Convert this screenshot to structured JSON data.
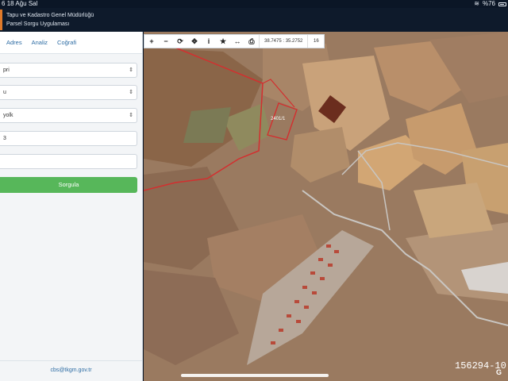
{
  "status": {
    "time_prefix": "6",
    "date": "18 Ağu Sal",
    "battery": "%76"
  },
  "header": {
    "line1": "Tapu ve Kadastro Genel Müdürlüğü",
    "line2": "Parsel Sorgu Uygulaması"
  },
  "tabs": [
    "Adres",
    "Analiz",
    "Coğrafi"
  ],
  "form": {
    "field1": "pri",
    "field2": "u",
    "field3": "yolk",
    "field4": "3",
    "field5": "",
    "submit": "Sorgula"
  },
  "footer": {
    "email": "cbs@tkgm.gov.tr"
  },
  "map": {
    "coords": "38.7475 : 35.2752",
    "zoom": "16",
    "parcel_label": "2401/1",
    "code": "156294-10",
    "logo": "G",
    "colors": {
      "parcel_outline": "#d32f2f",
      "selected_parcel": "#8b1a1a"
    }
  },
  "toolbar_icons": [
    "plus-icon",
    "minus-icon",
    "refresh-icon",
    "locate-icon",
    "info-icon",
    "star-icon",
    "measure-icon",
    "print-icon"
  ]
}
